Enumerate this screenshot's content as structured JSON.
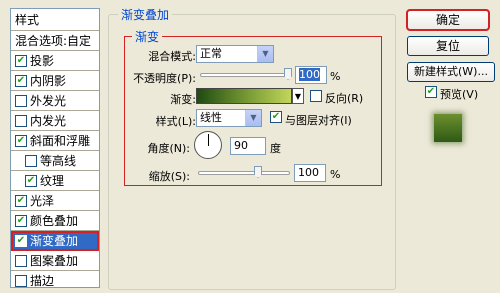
{
  "styles_panel": {
    "header": "样式",
    "blend_options": "混合选项:自定",
    "items": [
      {
        "label": "投影",
        "checked": true,
        "indent": false
      },
      {
        "label": "内阴影",
        "checked": true,
        "indent": false
      },
      {
        "label": "外发光",
        "checked": false,
        "indent": false
      },
      {
        "label": "内发光",
        "checked": false,
        "indent": false
      },
      {
        "label": "斜面和浮雕",
        "checked": true,
        "indent": false
      },
      {
        "label": "等高线",
        "checked": false,
        "indent": true
      },
      {
        "label": "纹理",
        "checked": true,
        "indent": true
      },
      {
        "label": "光泽",
        "checked": true,
        "indent": false
      },
      {
        "label": "颜色叠加",
        "checked": true,
        "indent": false
      },
      {
        "label": "渐变叠加",
        "checked": true,
        "indent": false,
        "selected": true
      },
      {
        "label": "图案叠加",
        "checked": false,
        "indent": false
      },
      {
        "label": "描边",
        "checked": false,
        "indent": false
      }
    ]
  },
  "gradient_overlay": {
    "group_title": "渐变叠加",
    "inner_title": "渐变",
    "blend_mode_label": "混合模式:",
    "blend_mode_value": "正常",
    "opacity_label": "不透明度(P):",
    "opacity_value": "100",
    "opacity_unit": "%",
    "opacity_level": 1.0,
    "gradient_label": "渐变:",
    "reverse_label": "反向(R)",
    "reverse_checked": false,
    "style_label": "样式(L):",
    "style_value": "线性",
    "align_label": "与图层对齐(I)",
    "align_checked": true,
    "angle_label": "角度(N):",
    "angle_value": "90",
    "angle_unit": "度",
    "scale_label": "缩放(S):",
    "scale_value": "100",
    "scale_unit": "%",
    "scale_level": 1.0
  },
  "buttons": {
    "ok": "确定",
    "reset": "复位",
    "new_style": "新建样式(W)...",
    "preview_label": "预览(V)",
    "preview_checked": true
  },
  "colors": {
    "selection": "#316AC5",
    "highlight_border": "#D32222",
    "title_blue": "#0046D5"
  }
}
